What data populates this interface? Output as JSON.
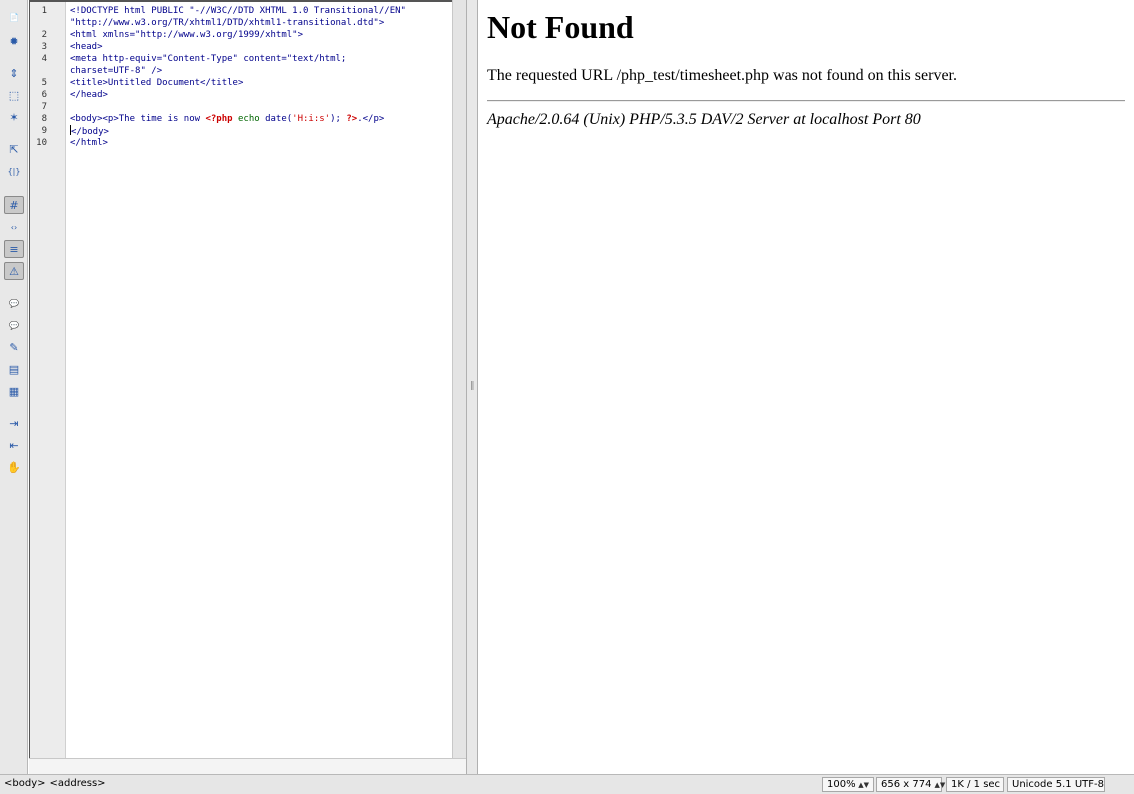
{
  "toolbar": {
    "buttons": [
      {
        "name": "open-documents-icon",
        "glyph": "📄"
      },
      {
        "name": "show-code-navigator-icon",
        "glyph": "✹"
      },
      {
        "name": "collapse-full-tag-icon",
        "glyph": "⇕"
      },
      {
        "name": "collapse-selection-icon",
        "glyph": "⬚"
      },
      {
        "name": "expand-all-icon",
        "glyph": "✶"
      },
      {
        "name": "select-parent-tag-icon",
        "glyph": "⇱"
      },
      {
        "name": "balance-braces-icon",
        "glyph": "{|}"
      },
      {
        "name": "line-numbers-icon",
        "glyph": "#"
      },
      {
        "name": "highlight-invalid-code-icon",
        "glyph": "‹›"
      },
      {
        "name": "word-wrap-icon",
        "glyph": "≡"
      },
      {
        "name": "syntax-error-alerts-icon",
        "glyph": "⚠"
      },
      {
        "name": "apply-comment-icon",
        "glyph": "💬"
      },
      {
        "name": "remove-comment-icon",
        "glyph": "💬"
      },
      {
        "name": "wrap-tag-icon",
        "glyph": "✎"
      },
      {
        "name": "recent-snippets-icon",
        "glyph": "▤"
      },
      {
        "name": "move-or-convert-css-icon",
        "glyph": "▦"
      },
      {
        "name": "indent-code-icon",
        "glyph": "⇥"
      },
      {
        "name": "outdent-code-icon",
        "glyph": "⇤"
      },
      {
        "name": "format-source-code-icon",
        "glyph": "✋"
      }
    ]
  },
  "editor": {
    "lines": [
      {
        "num": "1",
        "text": "<!DOCTYPE html PUBLIC \"-//W3C//DTD XHTML 1.0 Transitional//EN\""
      },
      {
        "num": "",
        "text": "\"http://www.w3.org/TR/xhtml1/DTD/xhtml1-transitional.dtd\">"
      },
      {
        "num": "2",
        "text": "<html xmlns=\"http://www.w3.org/1999/xhtml\">"
      },
      {
        "num": "3",
        "text": "<head>"
      },
      {
        "num": "4",
        "text": "<meta http-equiv=\"Content-Type\" content=\"text/html;"
      },
      {
        "num": "",
        "text": "charset=UTF-8\" />"
      },
      {
        "num": "5",
        "text": "<title>Untitled Document</title>"
      },
      {
        "num": "6",
        "text": "</head>"
      },
      {
        "num": "7",
        "text": ""
      },
      {
        "num": "8",
        "text": "PHP_LINE"
      },
      {
        "num": "9",
        "text": "</body>"
      },
      {
        "num": "10",
        "text": "</html>"
      }
    ],
    "php_line": {
      "pre": "<body><p>The time is now ",
      "open": "<?php",
      "echo": " echo ",
      "fn": "date(",
      "arg": "'H:i:s'",
      "close_paren": "); ",
      "close": "?>",
      "post": ".</p>"
    }
  },
  "live_view": {
    "heading": "Not Found",
    "message": "The requested URL /php_test/timesheet.php was not found on this server.",
    "address": "Apache/2.0.64 (Unix) PHP/5.3.5 DAV/2 Server at localhost Port 80"
  },
  "statusbar": {
    "tags": [
      "<body>",
      "<address>"
    ],
    "zoom": "100%",
    "window_size": "656 x 774",
    "download_stats": "1K / 1 sec",
    "encoding": "Unicode 5.1 UTF-8"
  }
}
